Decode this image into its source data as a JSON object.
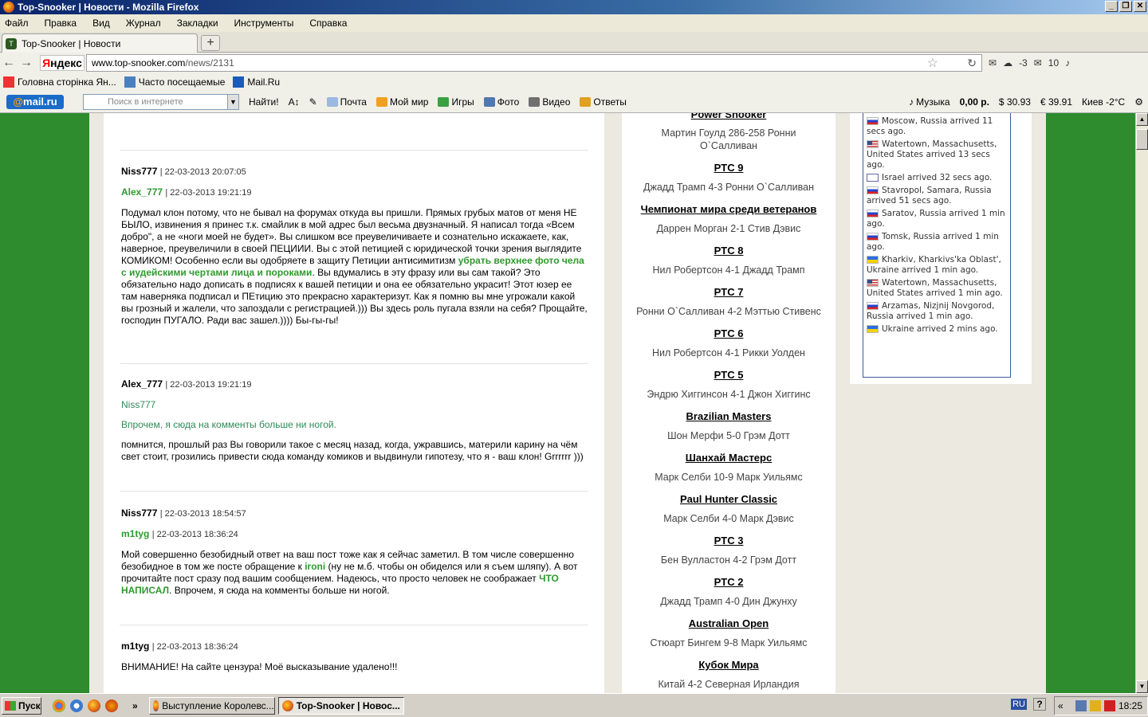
{
  "window": {
    "title": "Top-Snooker | Новости - Mozilla Firefox",
    "controls": [
      "_",
      "❐",
      "✕"
    ]
  },
  "menu": [
    "Файл",
    "Правка",
    "Вид",
    "Журнал",
    "Закладки",
    "Инструменты",
    "Справка"
  ],
  "tab": {
    "label": "Top-Snooker | Новости",
    "new_tab": "+"
  },
  "nav": {
    "back": "←",
    "forward": "→",
    "yandex_first": "Я",
    "yandex_rest": "ндекс",
    "url_domain": "www.top-snooker.com",
    "url_path": "/news/2131",
    "weather": "-3",
    "mail_count": "10"
  },
  "bookmarks": [
    "Головна сторінка Ян...",
    "Часто посещаемые",
    "Mail.Ru"
  ],
  "mailbar": {
    "logo_at": "@",
    "logo_text": "mail.ru",
    "search_placeholder": "Поиск в интернете",
    "find_button": "Найти!",
    "links": [
      "Почта",
      "Мой мир",
      "Игры",
      "Фото",
      "Видео",
      "Ответы"
    ],
    "music": "Музыка",
    "balance": "0,00 р.",
    "usd": "$ 30.93",
    "eur": "€ 39.91",
    "weather": "Киев -2°C"
  },
  "comments": [
    {
      "author": "Niss777",
      "date": "| 22-03-2013 20:07:05",
      "reply_author": "Alex_777",
      "reply_date": "| 22-03-2013 19:21:19",
      "text_1": "Подумал клон потому, что не бывал на форумах откуда вы пришли. Прямых грубых матов от меня НЕ БЫЛО, извинения я принес т.к. смайлик в мой адрес был весьма двузначный.  Я написал тогда «Всем добро\", а не «ноги моей не будет». Вы слишком все преувеличиваете и сознательно искажаете, как, наверное, преувеличили в своей ПЕЦИИИ. Вы с этой петицией с юридической точки зрения выглядите КОМИКОМ! Особенно если вы одобряете в защиту Петиции антисимитизм ",
      "text_green": "убрать верхнее фото чела с иудейскими чертами лица и пороками",
      "text_2": ". Вы вдумались в эту фразу или вы сам такой? Это обязательно надо дописать в подписях к вашей петиции и она ее обязательно украсит! Этот юзер ее там наверняка подписал и ПЕтицию это прекрасно характеризут. Как я помню вы мне  угрожали какой вы грозный и жалели, что запоздали с регистрацией.))) Вы здесь роль пугала взяли на себя? Прощайте, господин ПУГАЛО. Ради вас зашел.)))) Бы-гы-гы!"
    },
    {
      "author": "Alex_777",
      "date": "| 22-03-2013 19:21:19",
      "quote_author": "Niss777",
      "quote_text": " Впрочем, я сюда на комменты больше ни ногой.",
      "text": "помнится, прошлый раз Вы говорили такое с месяц назад, когда, ужравшись, материли карину на чём свет стоит, грозились привести сюда команду комиков и выдвинули гипотезу, что я - ваш клон! Grrrrrr )))"
    },
    {
      "author": "Niss777",
      "date": "| 22-03-2013 18:54:57",
      "reply_author": "m1tyg",
      "reply_date": "| 22-03-2013 18:36:24",
      "text_1": "Мой совершенно безобидный ответ на ваш пост тоже как я сейчас заметил. В том числе совершенно безобидное в том же посте обращение к ",
      "text_green": "ironi",
      "text_2": " (ну не м.б. чтобы он обиделся или я съем шляпу). А вот прочитайте пост сразу под вашим сообщением. Надеюсь, что просто человек не соображает ",
      "text_green_2": "ЧТО НАПИСАЛ",
      "text_3": ". Впрочем, я сюда на комменты больше ни ногой."
    },
    {
      "author": "m1tyg",
      "date": "| 22-03-2013 18:36:24",
      "text": "ВНИМАНИЕ! На сайте цензура! Моё высказывание удалено!!!"
    }
  ],
  "results": [
    {
      "title": "Power Snooker",
      "result": "Мартин Гоулд 286-258 Ронни О`Салливан"
    },
    {
      "title": "PTC 9",
      "result": "Джадд Трамп 4-3 Ронни О`Салливан"
    },
    {
      "title": "Чемпионат мира среди ветеранов",
      "result": "Даррен Морган 2-1 Стив Дэвис"
    },
    {
      "title": "PTC 8",
      "result": "Нил Робертсон 4-1 Джадд Трамп"
    },
    {
      "title": "PTC 7",
      "result": "Ронни О`Салливан 4-2 Мэттью Стивенс"
    },
    {
      "title": "PTC 6",
      "result": "Нил Робертсон 4-1 Рикки Уолден"
    },
    {
      "title": "PTC 5",
      "result": "Эндрю Хиггинсон 4-1 Джон Хиггинс"
    },
    {
      "title": "Brazilian Masters",
      "result": "Шон Мерфи 5-0 Грэм Дотт"
    },
    {
      "title": "Шанхай Мастерс",
      "result": "Марк Селби 10-9 Марк Уильямс"
    },
    {
      "title": "Paul Hunter Classic",
      "result": "Марк Селби 4-0 Марк Дэвис"
    },
    {
      "title": "PTC 3",
      "result": "Бен Вулластон 4-2 Грэм Дотт"
    },
    {
      "title": "PTC 2",
      "result": "Джадд Трамп 4-0 Дин Джунху"
    },
    {
      "title": "Australian Open",
      "result": "Стюарт Бингем 9-8 Марк Уильямс"
    },
    {
      "title": "Кубок Мира",
      "result": "Китай 4-2 Северная Ирландия"
    }
  ],
  "visitors": [
    {
      "flag": "ru",
      "text": "Moscow, Russia arrived 11 secs ago."
    },
    {
      "flag": "us",
      "text": "Watertown, Massachusetts, United States arrived 13 secs ago."
    },
    {
      "flag": "il",
      "text": "Israel arrived 32 secs ago."
    },
    {
      "flag": "ru",
      "text": "Stavropol, Samara, Russia arrived 51 secs ago."
    },
    {
      "flag": "ru",
      "text": "Saratov, Russia arrived 1 min ago."
    },
    {
      "flag": "ru",
      "text": "Tomsk, Russia arrived 1 min ago."
    },
    {
      "flag": "ua",
      "text": "Kharkiv, Kharkivs'ka Oblast', Ukraine arrived 1 min ago."
    },
    {
      "flag": "us",
      "text": "Watertown, Massachusetts, United States arrived 1 min ago."
    },
    {
      "flag": "ru",
      "text": "Arzamas, Nizjnij Novgorod, Russia arrived 1 min ago."
    },
    {
      "flag": "ua",
      "text": "Ukraine arrived 2 mins ago."
    }
  ],
  "taskbar": {
    "start": "Пуск",
    "more": "»",
    "tasks": [
      "Выступление Королевс...",
      "Top-Snooker | Новос..."
    ],
    "lang": "RU",
    "help": "?",
    "tray_arrow": "«",
    "clock": "18:25"
  }
}
